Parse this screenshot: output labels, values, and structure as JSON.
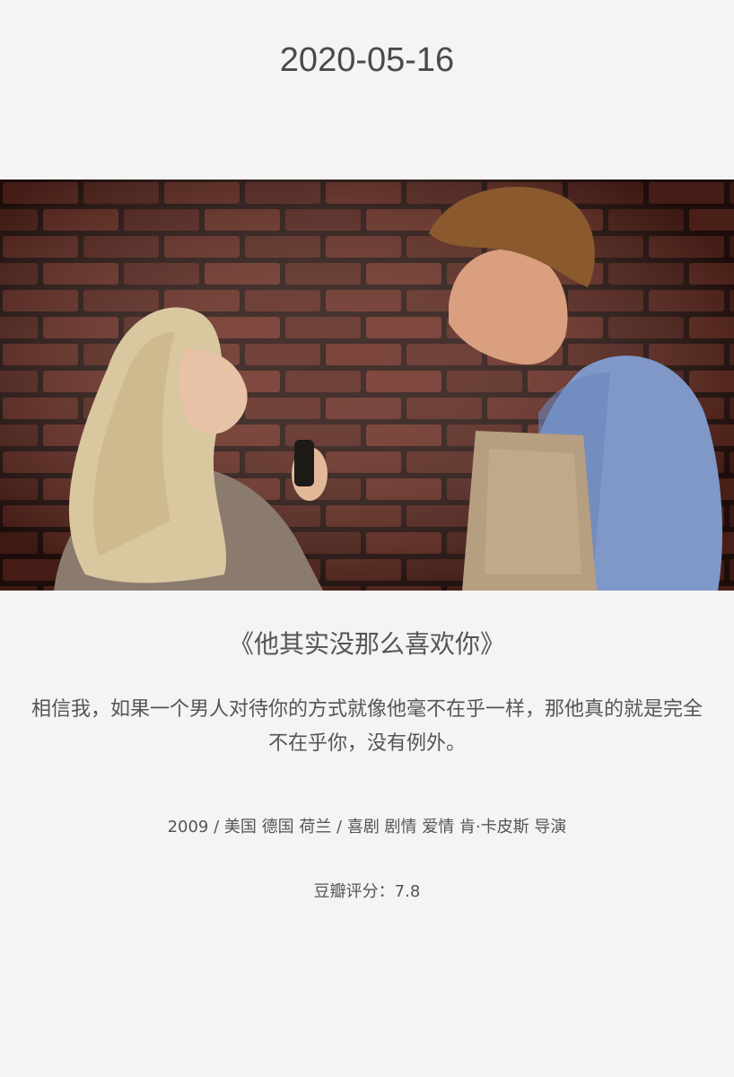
{
  "date": "2020-05-16",
  "movie": {
    "title": "《他其实没那么喜欢你》",
    "quote": "相信我，如果一个男人对待你的方式就像他毫不在乎一样，那他真的就是完全不在乎你，没有例外。",
    "meta": "2009 / 美国 德国 荷兰 / 喜剧 剧情 爱情 肯·卡皮斯 导演",
    "rating": "豆瓣评分：7.8"
  },
  "colors": {
    "background": "#f4f4f4",
    "text": "#4a4a4a",
    "brick": "#6b2e22",
    "mortar": "#2a1410"
  }
}
